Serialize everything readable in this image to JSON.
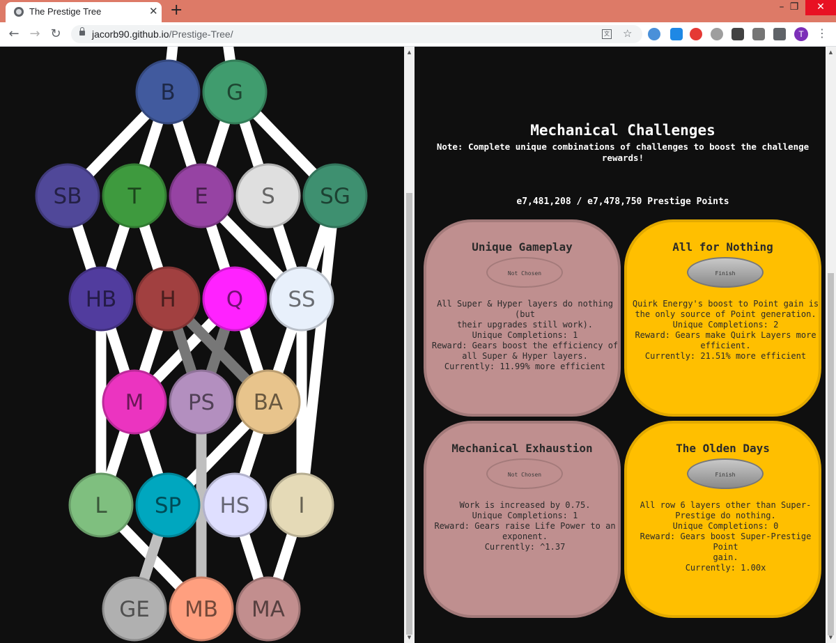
{
  "browser": {
    "tab_title": "The Prestige Tree",
    "tab_close": "✕",
    "new_tab": "+",
    "url_host": "jacorb90.github.io",
    "url_path": "/Prestige-Tree/",
    "profile_initial": "T",
    "window_controls": {
      "minimize": "–",
      "restore": "❐",
      "close": "✕"
    },
    "nav": {
      "back": "←",
      "forward": "→",
      "reload": "↻"
    }
  },
  "tree": {
    "nodes": [
      {
        "id": "B",
        "label": "B",
        "color": "#415a9e"
      },
      {
        "id": "G",
        "label": "G",
        "color": "#409c6e"
      },
      {
        "id": "SB",
        "label": "SB",
        "color": "#504899"
      },
      {
        "id": "T",
        "label": "T",
        "color": "#3e9a3e"
      },
      {
        "id": "E",
        "label": "E",
        "color": "#9643a3"
      },
      {
        "id": "S",
        "label": "S",
        "color": "#dfdfdf"
      },
      {
        "id": "SG",
        "label": "SG",
        "color": "#3e9070"
      },
      {
        "id": "HB",
        "label": "HB",
        "color": "#513c9e"
      },
      {
        "id": "H",
        "label": "H",
        "color": "#a14040"
      },
      {
        "id": "Q",
        "label": "Q",
        "color": "#ff22ff"
      },
      {
        "id": "SS",
        "label": "SS",
        "color": "#e8f0fb"
      },
      {
        "id": "M",
        "label": "M",
        "color": "#eb34c0"
      },
      {
        "id": "PS",
        "label": "PS",
        "color": "#b38fbf"
      },
      {
        "id": "BA",
        "label": "BA",
        "color": "#e8c48c"
      },
      {
        "id": "L",
        "label": "L",
        "color": "#7fbf7f"
      },
      {
        "id": "SP",
        "label": "SP",
        "color": "#00a7bf"
      },
      {
        "id": "HS",
        "label": "HS",
        "color": "#dfdfff"
      },
      {
        "id": "I",
        "label": "I",
        "color": "#e5dab7"
      },
      {
        "id": "GE",
        "label": "GE",
        "color": "#b0b0b0"
      },
      {
        "id": "MB",
        "label": "MB",
        "color": "#ff9f7f"
      },
      {
        "id": "MA",
        "label": "MA",
        "color": "#c28e8e"
      }
    ]
  },
  "challenges_panel": {
    "title": "Mechanical Challenges",
    "note": "Note: Complete unique combinations of challenges to boost the challenge rewards!",
    "points": "e7,481,208 / e7,478,750 Prestige Points",
    "challenges": [
      {
        "title": "Unique Gameplay",
        "status": "locked",
        "button": "Not Chosen",
        "desc": [
          "All Super & Hyper layers do nothing (but",
          "their upgrades still work).",
          "Unique Completions: 1",
          "Reward: Gears boost the efficiency of",
          "all Super & Hyper layers.",
          "Currently: 11.99% more efficient"
        ]
      },
      {
        "title": "All for Nothing",
        "status": "done",
        "button": "Finish",
        "desc": [
          "Quirk Energy's boost to Point gain is",
          "the only source of Point generation.",
          "Unique Completions: 2",
          "Reward: Gears make Quirk Layers more",
          "efficient.",
          "Currently: 21.51% more efficient"
        ]
      },
      {
        "title": "Mechanical Exhaustion",
        "status": "locked",
        "button": "Not Chosen",
        "desc": [
          "Work is increased by 0.75.",
          "Unique Completions: 1",
          "Reward: Gears raise Life Power to an",
          "exponent.",
          "Currently: ^1.37"
        ]
      },
      {
        "title": "The Olden Days",
        "status": "done",
        "button": "Finish",
        "desc": [
          "All row 6 layers other than Super-",
          "Prestige do nothing.",
          "Unique Completions: 0",
          "Reward: Gears boost Super-Prestige Point",
          "gain.",
          "Currently: 1.00x"
        ]
      }
    ]
  }
}
